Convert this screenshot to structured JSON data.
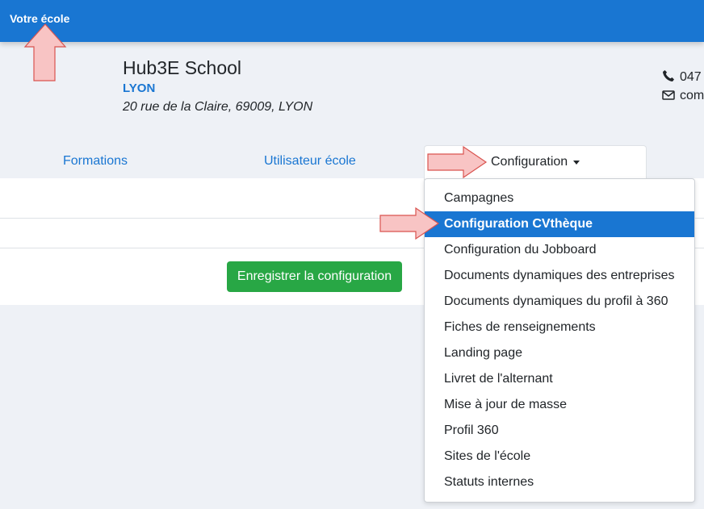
{
  "topbar": {
    "brand": "Votre école"
  },
  "school": {
    "name": "Hub3E School",
    "city": "LYON",
    "address": "20 rue de la Claire, 69009, LYON",
    "phone": "047",
    "email": "com"
  },
  "tabs": {
    "formations": "Formations",
    "users": "Utilisateur école",
    "config": "Configuration"
  },
  "form": {
    "save_label": "Enregistrer la configuration"
  },
  "dropdown": {
    "items": [
      "Campagnes",
      "Configuration CVthèque",
      "Configuration du Jobboard",
      "Documents dynamiques des entreprises",
      "Documents dynamiques du profil à 360",
      "Fiches de renseignements",
      "Landing page",
      "Livret de l'alternant",
      "Mise à jour de masse",
      "Profil 360",
      "Sites de l'école",
      "Statuts internes"
    ],
    "active_index": 1
  },
  "colors": {
    "primary": "#1976d2",
    "success": "#28a745",
    "annotation_fill": "#f8c4c4",
    "annotation_stroke": "#d9534f"
  },
  "icons": {
    "phone": "phone-icon",
    "email": "envelope-icon",
    "caret": "caret-down-icon"
  }
}
